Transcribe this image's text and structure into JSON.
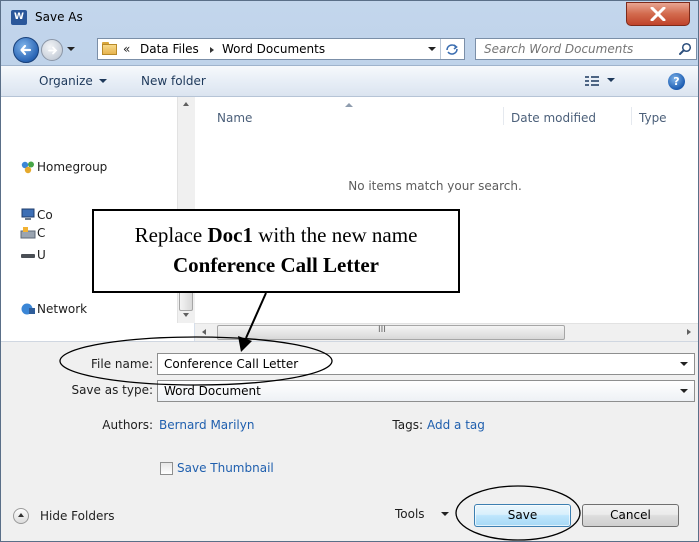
{
  "window": {
    "title": "Save As",
    "app_icon_letter": "W"
  },
  "address_bar": {
    "overflow": "«",
    "crumbs": [
      "Data Files",
      "Word Documents"
    ]
  },
  "search": {
    "placeholder": "Search Word Documents"
  },
  "command_bar": {
    "organize": "Organize",
    "new_folder": "New folder",
    "help": "?"
  },
  "nav_pane": {
    "items": [
      "Homegroup",
      "Co",
      "C",
      "U",
      "Network"
    ]
  },
  "file_list": {
    "columns": [
      "Name",
      "Date modified",
      "Type"
    ],
    "empty_message": "No items match your search.",
    "hscroll_grip": "III"
  },
  "form": {
    "file_name_label": "File name:",
    "file_name_value": "Conference Call Letter",
    "save_as_type_label": "Save as type:",
    "save_as_type_value": "Word Document",
    "authors_label": "Authors:",
    "authors_value": "Bernard Marilyn",
    "tags_label": "Tags:",
    "tags_value": "Add a tag",
    "thumbnail_label": "Save Thumbnail"
  },
  "footer": {
    "hide_folders": "Hide Folders",
    "tools": "Tools",
    "save": "Save",
    "cancel": "Cancel"
  },
  "callout": {
    "pre": "Replace ",
    "bold1": "Doc1",
    "mid": " with the new name ",
    "bold2": "Conference Call Letter"
  },
  "colors": {
    "link": "#1f5fae",
    "chrome": "#b6cbe6",
    "close": "#c0432b"
  }
}
